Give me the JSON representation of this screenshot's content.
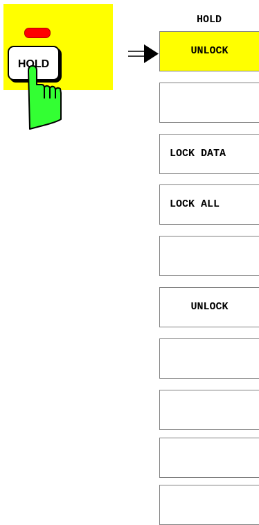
{
  "hardkey": {
    "label": "HOLD",
    "led_color": "#ff0000",
    "panel_color": "#ffff00",
    "hand_color": "#33ff33"
  },
  "menu": {
    "title": "HOLD",
    "softkeys": [
      {
        "label": "UNLOCK",
        "active": true
      },
      {
        "label": ""
      },
      {
        "label": "LOCK DATA"
      },
      {
        "label": "LOCK ALL"
      },
      {
        "label": ""
      },
      {
        "label": "UNLOCK"
      },
      {
        "label": ""
      },
      {
        "label": ""
      },
      {
        "label": ""
      },
      {
        "label": ""
      }
    ]
  }
}
